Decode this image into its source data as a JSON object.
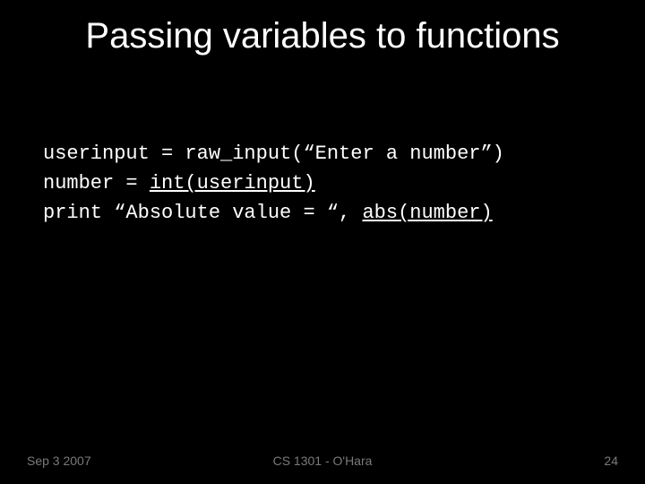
{
  "title": "Passing variables to functions",
  "code": {
    "line1": "userinput = raw_input(“Enter a number”)",
    "line2_pre": "number = ",
    "line2_u": "int(userinput)",
    "line3_pre": "print “Absolute value = “, ",
    "line3_u": "abs(number)"
  },
  "footer": {
    "date": "Sep 3 2007",
    "course": "CS 1301 - O'Hara",
    "page": "24"
  }
}
